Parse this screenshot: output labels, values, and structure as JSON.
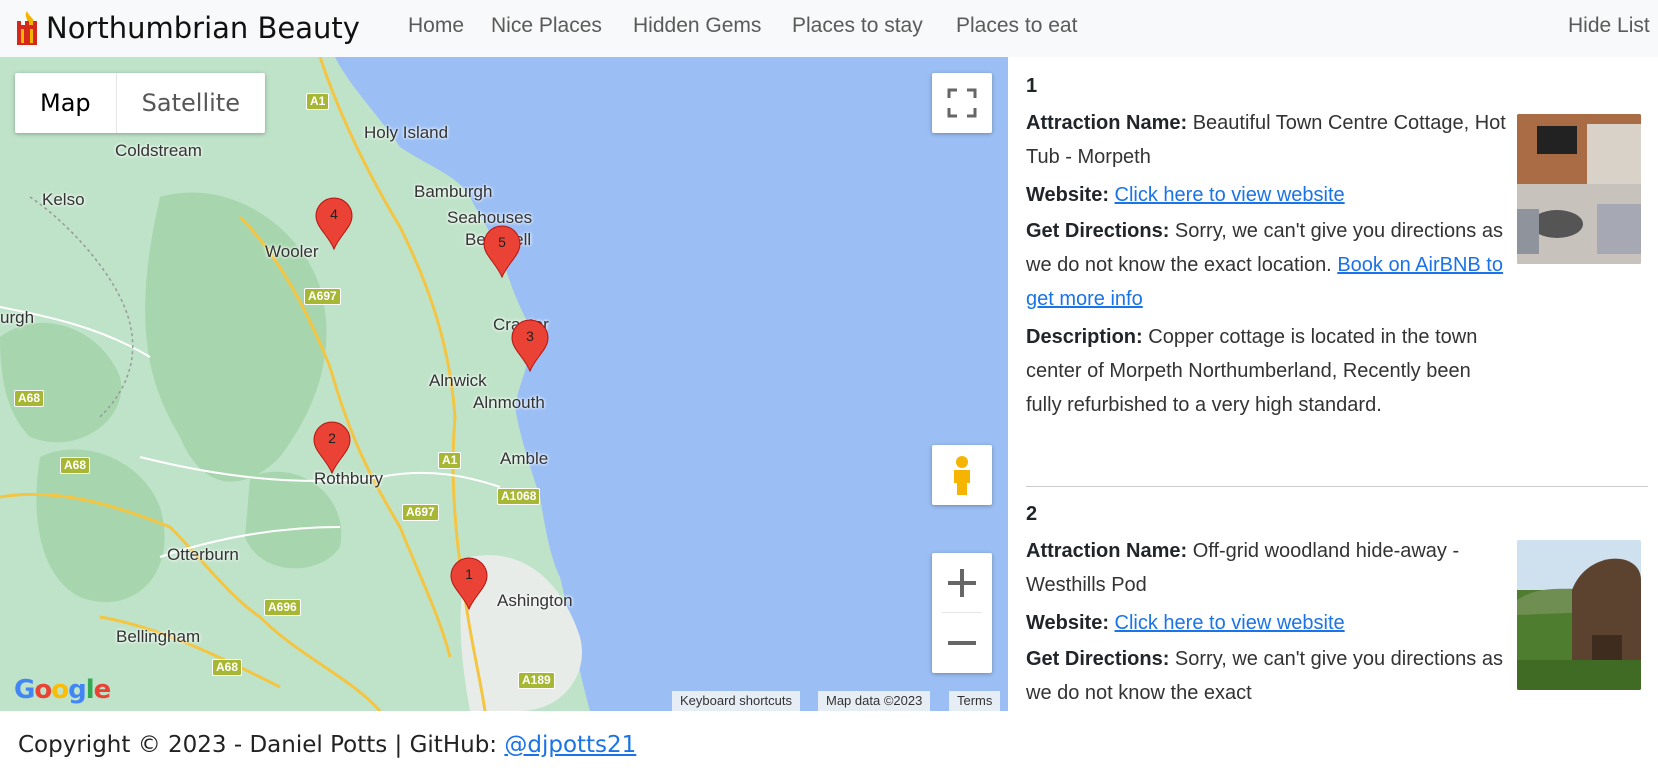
{
  "navbar": {
    "brand": "Northumbrian Beauty",
    "links": [
      "Home",
      "Nice Places",
      "Hidden Gems",
      "Places to stay",
      "Places to eat"
    ],
    "toggle_list": "Hide List"
  },
  "map": {
    "type_options": [
      "Map",
      "Satellite"
    ],
    "selected_type": "Map",
    "places": [
      "Holy Island",
      "Coldstream",
      "Kelso",
      "Bamburgh",
      "Seahouses",
      "Beadnell",
      "Wooler",
      "urgh",
      "Craster",
      "Alnwick",
      "Alnmouth",
      "Amble",
      "Rothbury",
      "Otterburn",
      "Ashington",
      "Bellingham"
    ],
    "roads": [
      "A1",
      "A697",
      "A68",
      "A68",
      "A1",
      "A1068",
      "A697",
      "A696",
      "A68",
      "A189"
    ],
    "markers": [
      "1",
      "2",
      "3",
      "4",
      "5"
    ],
    "attribution": {
      "shortcuts": "Keyboard shortcuts",
      "data": "Map data ©2023",
      "terms": "Terms"
    },
    "logo": "Google"
  },
  "list": [
    {
      "number": "1",
      "name_label": "Attraction Name:",
      "name": "Beautiful Town Centre Cottage, Hot Tub - Morpeth",
      "website_label": "Website:",
      "website_link": "Click here to view website",
      "directions_label": "Get Directions:",
      "directions_text": "Sorry, we can't give you directions as we do not know the exact location.",
      "booking_link": "Book on AirBNB to get more info",
      "description_label": "Description:",
      "description": "Copper cottage is located in the town center of Morpeth Northumberland, Recently been fully refurbished to a very high standard."
    },
    {
      "number": "2",
      "name_label": "Attraction Name:",
      "name": "Off-grid woodland hide-away - Westhills Pod",
      "website_label": "Website:",
      "website_link": "Click here to view website",
      "directions_label": "Get Directions:",
      "directions_text": "Sorry, we can't give you directions as we do not know the exact"
    }
  ],
  "footer": {
    "text": "Copyright © 2023 - Daniel Potts | GitHub: ",
    "link": "@djpotts21"
  },
  "colors": {
    "water": "#9bbff4",
    "land": "#bfe3c9",
    "marker": "#ea4335",
    "link": "#1a73e8"
  }
}
